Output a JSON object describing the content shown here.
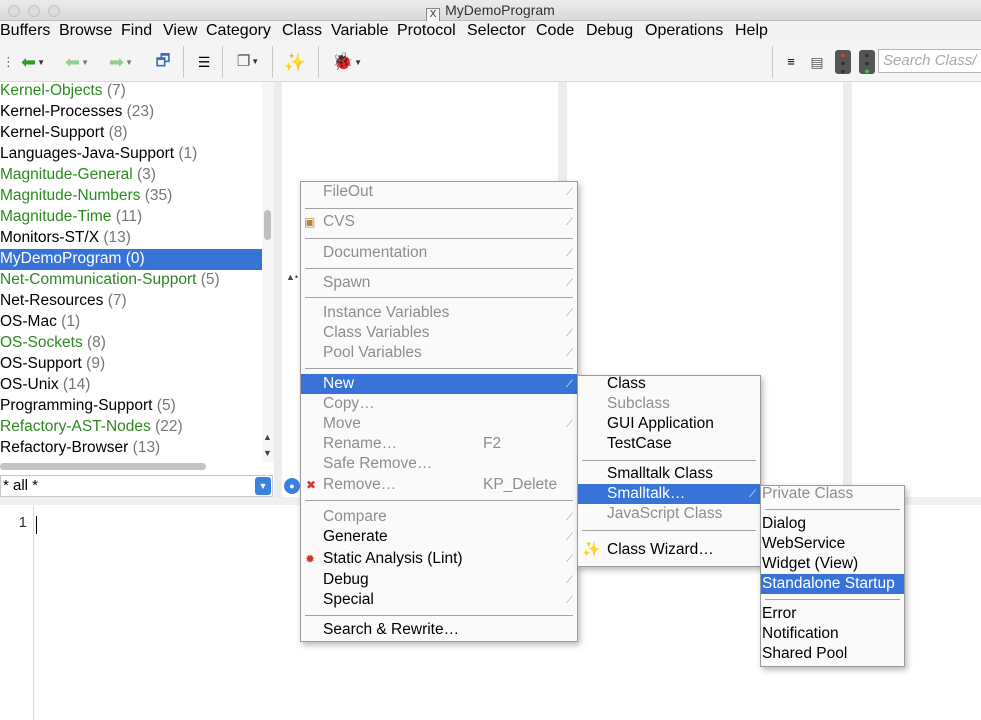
{
  "window": {
    "title": "MyDemoProgram",
    "x_icon": "X"
  },
  "menubar": [
    "Buffers",
    "Browse",
    "Find",
    "View",
    "Category",
    "Class",
    "Variable",
    "Protocol",
    "Selector",
    "Code",
    "Debug",
    "Operations",
    "Help"
  ],
  "toolbar": {
    "search_placeholder": "Search Class/",
    "icons": [
      "dotted-grip-icon",
      "back-arrow-icon",
      "back-arrow-alt-icon",
      "forward-arrow-icon",
      "new-window-icon",
      "hierarchy-icon",
      "windows-stack-icon",
      "wizard-wand-icon",
      "debug-bug-icon",
      "format-icon",
      "document-icon",
      "traffic-red-icon",
      "traffic-green-icon"
    ]
  },
  "categories": [
    {
      "name": "Kernel-Objects",
      "count": "(7)",
      "green": true
    },
    {
      "name": "Kernel-Processes",
      "count": "(23)",
      "green": false
    },
    {
      "name": "Kernel-Support",
      "count": "(8)",
      "green": false
    },
    {
      "name": "Languages-Java-Support",
      "count": "(1)",
      "green": false
    },
    {
      "name": "Magnitude-General",
      "count": "(3)",
      "green": true
    },
    {
      "name": "Magnitude-Numbers",
      "count": "(35)",
      "green": true
    },
    {
      "name": "Magnitude-Time",
      "count": "(11)",
      "green": true
    },
    {
      "name": "Monitors-ST/X",
      "count": "(13)",
      "green": false
    },
    {
      "name": "MyDemoProgram",
      "count": "(0)",
      "green": false,
      "selected": true
    },
    {
      "name": "Net-Communication-Support",
      "count": "(5)",
      "green": true
    },
    {
      "name": "Net-Resources",
      "count": "(7)",
      "green": false
    },
    {
      "name": "OS-Mac",
      "count": "(1)",
      "green": false
    },
    {
      "name": "OS-Sockets",
      "count": "(8)",
      "green": true
    },
    {
      "name": "OS-Support",
      "count": "(9)",
      "green": false
    },
    {
      "name": "OS-Unix",
      "count": "(14)",
      "green": false
    },
    {
      "name": "Programming-Support",
      "count": "(5)",
      "green": false
    },
    {
      "name": "Refactory-AST-Nodes",
      "count": "(22)",
      "green": true
    },
    {
      "name": "Refactory-Browser",
      "count": "(13)",
      "green": false
    }
  ],
  "filter": {
    "value": "* all *"
  },
  "editor": {
    "line_number": "1"
  },
  "class_menu": {
    "items": [
      {
        "label": "FileOut",
        "disabled": true,
        "submenu": true
      },
      {
        "sep": true
      },
      {
        "label": "CVS",
        "disabled": true,
        "submenu": true,
        "icon": "cvs-icon"
      },
      {
        "sep": true
      },
      {
        "label": "Documentation",
        "disabled": true,
        "submenu": true
      },
      {
        "sep": true
      },
      {
        "label": "Spawn",
        "disabled": true,
        "submenu": true
      },
      {
        "sep": true
      },
      {
        "label": "Instance Variables",
        "disabled": true,
        "submenu": true
      },
      {
        "label": "Class Variables",
        "disabled": true,
        "submenu": true
      },
      {
        "label": "Pool Variables",
        "disabled": true,
        "submenu": true
      },
      {
        "sep": true
      },
      {
        "label": "New",
        "highlighted": true,
        "submenu": true
      },
      {
        "label": "Copy…",
        "disabled": true
      },
      {
        "label": "Move",
        "disabled": true,
        "submenu": true
      },
      {
        "label": "Rename…",
        "disabled": true,
        "shortcut": "F2"
      },
      {
        "label": "Safe Remove…",
        "disabled": true
      },
      {
        "label": "Remove…",
        "disabled": true,
        "shortcut": "KP_Delete",
        "icon": "remove-x-icon"
      },
      {
        "sep": true
      },
      {
        "label": "Compare",
        "disabled": true,
        "submenu": true
      },
      {
        "label": "Generate",
        "submenu": true
      },
      {
        "label": "Static Analysis (Lint)",
        "submenu": true,
        "icon": "lint-bug-icon"
      },
      {
        "label": "Debug",
        "submenu": true
      },
      {
        "label": "Special",
        "submenu": true
      },
      {
        "sep": true
      },
      {
        "label": "Search & Rewrite…"
      }
    ]
  },
  "new_menu": {
    "items": [
      {
        "label": "Class"
      },
      {
        "label": "Subclass",
        "disabled": true
      },
      {
        "label": "GUI Application"
      },
      {
        "label": "TestCase"
      },
      {
        "sep": true
      },
      {
        "label": "Smalltalk Class"
      },
      {
        "label": "Smalltalk…",
        "highlighted": true,
        "submenu": true
      },
      {
        "label": "JavaScript Class",
        "disabled": true
      },
      {
        "sep": true
      },
      {
        "label": "Class Wizard…",
        "icon": "wizard-wand-icon"
      }
    ]
  },
  "smalltalk_menu": {
    "items": [
      {
        "label": "Private Class",
        "disabled": true
      },
      {
        "sep": true
      },
      {
        "label": "Dialog"
      },
      {
        "label": "WebService"
      },
      {
        "label": "Widget (View)"
      },
      {
        "label": "Standalone Startup",
        "highlighted": true
      },
      {
        "sep": true
      },
      {
        "label": "Error"
      },
      {
        "label": "Notification"
      },
      {
        "label": "Shared Pool"
      }
    ]
  }
}
